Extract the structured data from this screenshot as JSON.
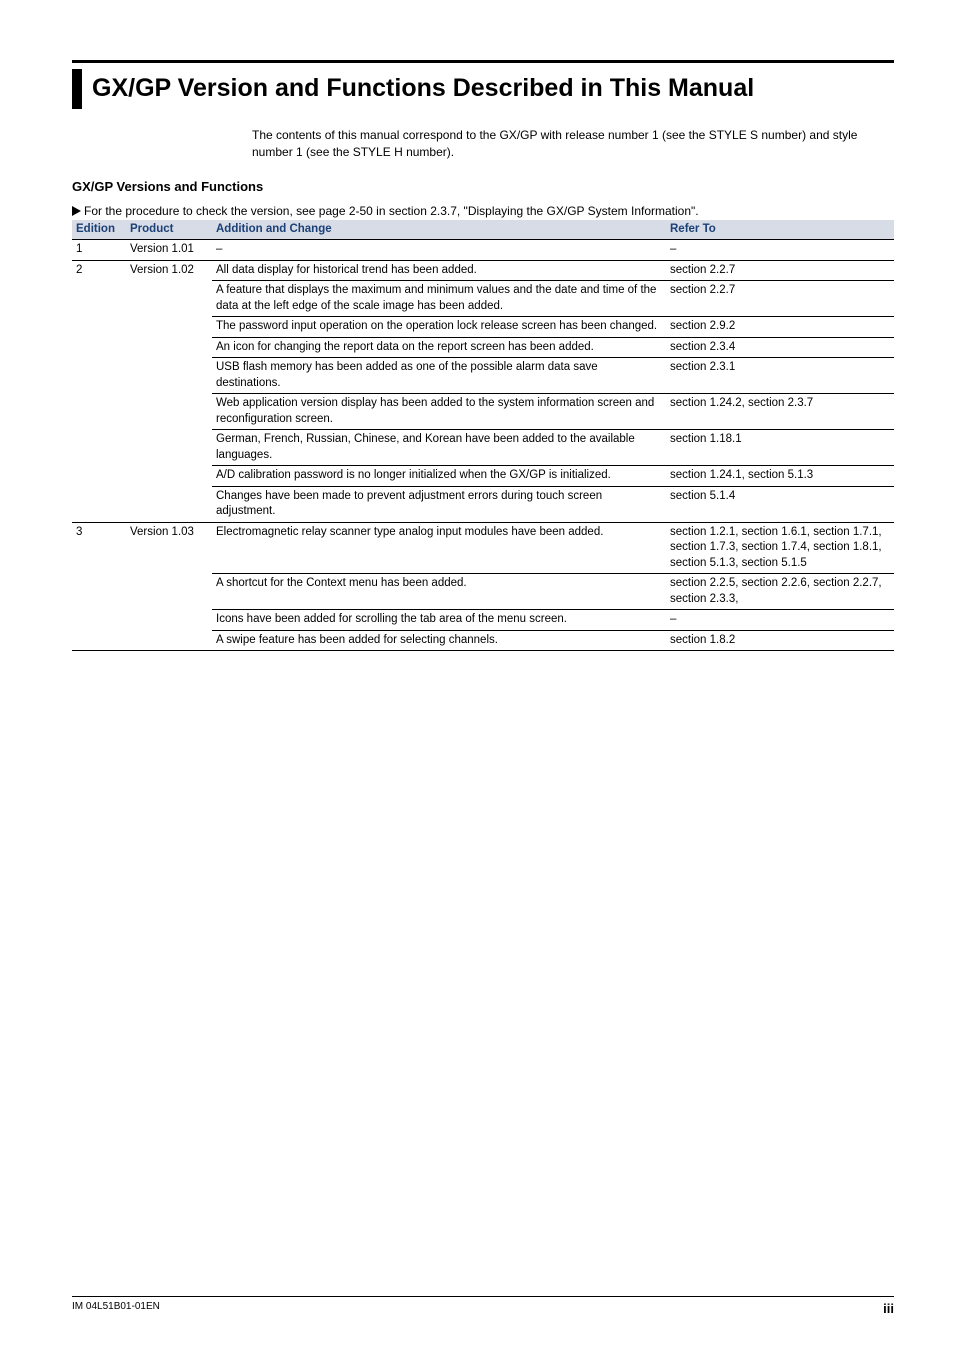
{
  "title": "GX/GP Version and Functions Described in This Manual",
  "intro": "The contents of this manual correspond to the GX/GP with release number 1 (see the STYLE S number) and style number 1 (see the STYLE H number).",
  "section_heading": "GX/GP Versions and Functions",
  "procedure_note": "For the procedure to check the version, see page 2-50 in section 2.3.7, \"Displaying the GX/GP System Information\".",
  "table": {
    "headers": {
      "edition": "Edition",
      "product": "Product",
      "addition": "Addition and Change",
      "refer": "Refer To"
    },
    "rows": [
      {
        "edition": "1",
        "product": "Version 1.01",
        "addition": "–",
        "refer": "–"
      },
      {
        "edition": "2",
        "product": "Version 1.02",
        "addition": "All data display for historical trend has been added.",
        "refer": "section 2.2.7"
      },
      {
        "edition": "",
        "product": "",
        "addition": "A feature that displays the maximum and minimum values and the date and time of the data at the left edge of the scale image has been added.",
        "refer": "section 2.2.7"
      },
      {
        "edition": "",
        "product": "",
        "addition": "The password input operation on the operation lock release screen has been changed.",
        "refer": "section 2.9.2"
      },
      {
        "edition": "",
        "product": "",
        "addition": "An icon for changing the report data on the report screen has been added.",
        "refer": "section 2.3.4"
      },
      {
        "edition": "",
        "product": "",
        "addition": "USB flash memory has been added as one of the possible alarm data save destinations.",
        "refer": "section 2.3.1"
      },
      {
        "edition": "",
        "product": "",
        "addition": "Web application version display has been added to the system information screen and reconfiguration screen.",
        "refer": "section 1.24.2, section 2.3.7"
      },
      {
        "edition": "",
        "product": "",
        "addition": "German, French, Russian, Chinese, and Korean have been added to the available languages.",
        "refer": "section 1.18.1"
      },
      {
        "edition": "",
        "product": "",
        "addition": "A/D calibration password is no longer initialized when the GX/GP is initialized.",
        "refer": "section 1.24.1, section 5.1.3"
      },
      {
        "edition": "",
        "product": "",
        "addition": "Changes have been made to prevent adjustment errors during touch screen adjustment.",
        "refer": "section 5.1.4"
      },
      {
        "edition": "3",
        "product": "Version 1.03",
        "addition": "Electromagnetic relay scanner type analog input modules have been added.",
        "refer": "section 1.2.1, section 1.6.1, section 1.7.1, section 1.7.3, section 1.7.4, section 1.8.1, section 5.1.3, section 5.1.5"
      },
      {
        "edition": "",
        "product": "",
        "addition": "A shortcut for the Context menu has been added.",
        "refer": "section 2.2.5, section 2.2.6, section 2.2.7, section 2.3.3,"
      },
      {
        "edition": "",
        "product": "",
        "addition": "Icons have been added for scrolling the tab area of the menu screen.",
        "refer": "–"
      },
      {
        "edition": "",
        "product": "",
        "addition": "A swipe feature has been added for selecting channels.",
        "refer": "section 1.8.2"
      }
    ]
  },
  "footer": {
    "doc_id": "IM 04L51B01-01EN",
    "page": "iii"
  }
}
